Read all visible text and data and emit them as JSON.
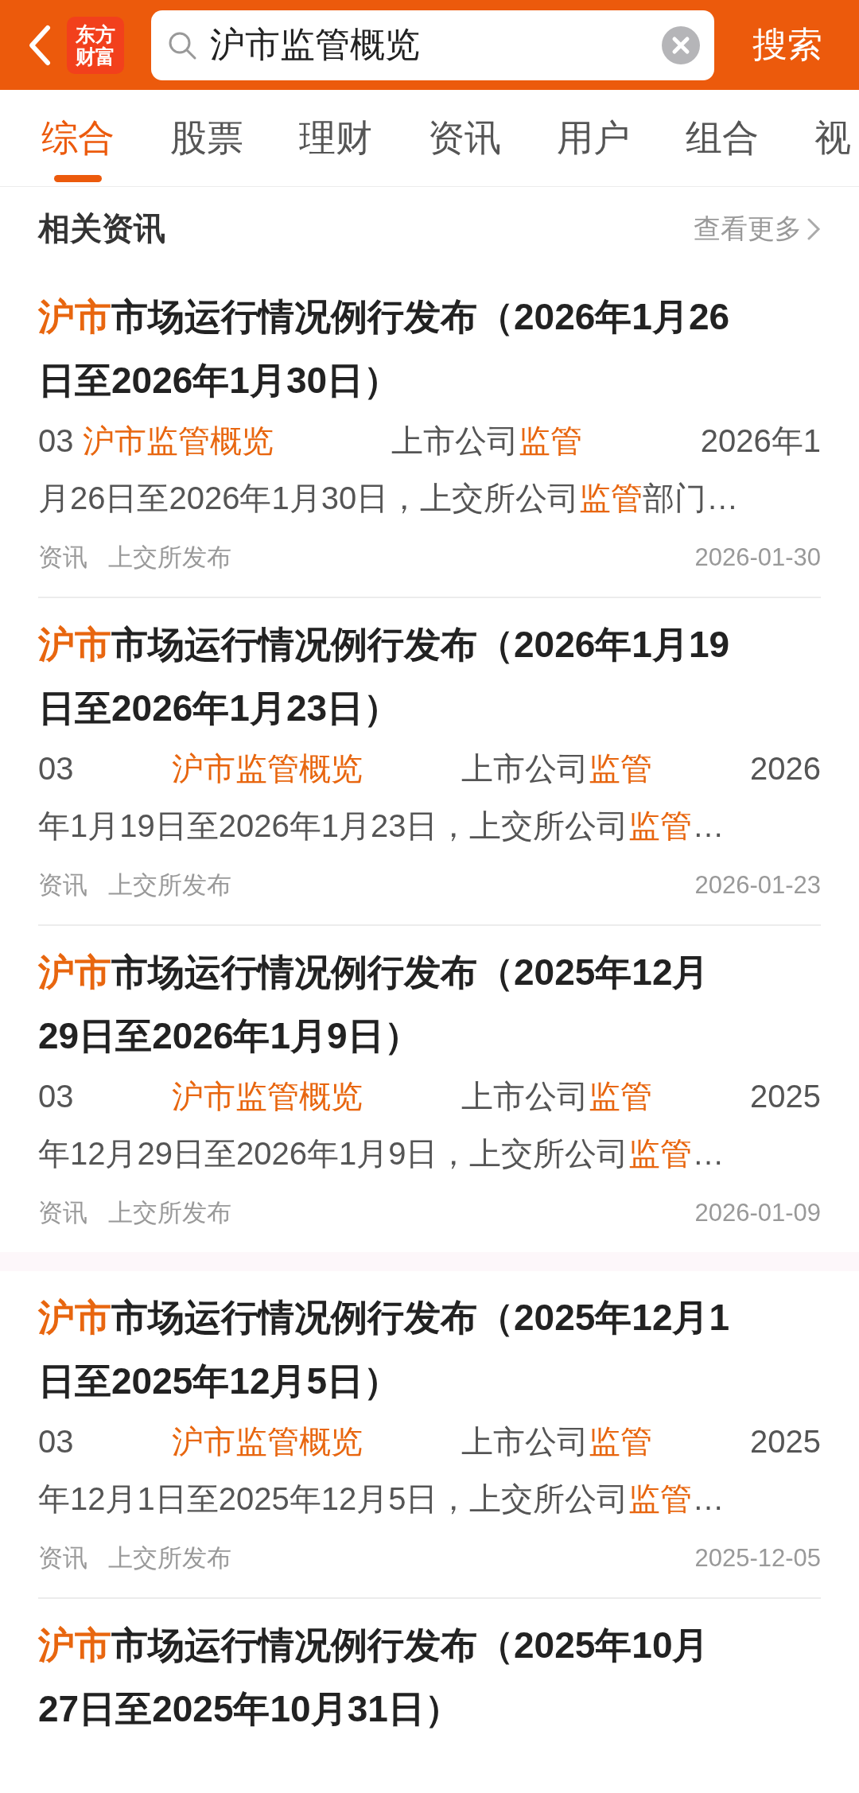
{
  "header": {
    "logo": [
      "东方",
      "财富"
    ],
    "search": {
      "value": "沪市监管概览"
    },
    "search_button": "搜索"
  },
  "tabs": [
    {
      "label": "综合",
      "selected": true
    },
    {
      "label": "股票",
      "selected": false
    },
    {
      "label": "理财",
      "selected": false
    },
    {
      "label": "资讯",
      "selected": false
    },
    {
      "label": "用户",
      "selected": false
    },
    {
      "label": "组合",
      "selected": false
    },
    {
      "label": "视",
      "selected": false
    }
  ],
  "section": {
    "title": "相关资讯",
    "more": "查看更多"
  },
  "news_groups": [
    [
      {
        "title": [
          [
            {
              "text": "沪市",
              "highlight": true
            },
            {
              "text": "市场运行情况例行发布（2026年1月26",
              "highlight": false
            }
          ],
          [
            {
              "text": "日至2026年1月30日）",
              "highlight": false
            }
          ]
        ],
        "snippet": [
          [
            [
              {
                "text": "03 ",
                "highlight": false
              },
              {
                "text": "沪市监管概览",
                "highlight": true
              }
            ],
            [
              {
                "text": "上市公司",
                "highlight": false
              },
              {
                "text": "监管",
                "highlight": true
              }
            ],
            [
              {
                "text": "2026年1",
                "highlight": false
              }
            ]
          ],
          [
            [
              {
                "text": "月26日至2026年1月30日，上交所公司",
                "highlight": false
              },
              {
                "text": "监管",
                "highlight": true
              },
              {
                "text": "部门…",
                "highlight": false
              }
            ]
          ]
        ],
        "meta": {
          "category": "资讯",
          "source": "上交所发布",
          "date": "2026-01-30"
        }
      },
      {
        "title": [
          [
            {
              "text": "沪市",
              "highlight": true
            },
            {
              "text": "市场运行情况例行发布（2026年1月19",
              "highlight": false
            }
          ],
          [
            {
              "text": "日至2026年1月23日）",
              "highlight": false
            }
          ]
        ],
        "snippet": [
          [
            [
              {
                "text": "03",
                "highlight": false
              }
            ],
            [
              {
                "text": "沪市监管概览",
                "highlight": true
              }
            ],
            [
              {
                "text": "上市公司",
                "highlight": false
              },
              {
                "text": "监管",
                "highlight": true
              }
            ],
            [
              {
                "text": "2026",
                "highlight": false
              }
            ]
          ],
          [
            [
              {
                "text": "年1月19日至2026年1月23日，上交所公司",
                "highlight": false
              },
              {
                "text": "监管",
                "highlight": true
              },
              {
                "text": "…",
                "highlight": false
              }
            ]
          ]
        ],
        "meta": {
          "category": "资讯",
          "source": "上交所发布",
          "date": "2026-01-23"
        }
      },
      {
        "title": [
          [
            {
              "text": "沪市",
              "highlight": true
            },
            {
              "text": "市场运行情况例行发布（2025年12月",
              "highlight": false
            }
          ],
          [
            {
              "text": "29日至2026年1月9日）",
              "highlight": false
            }
          ]
        ],
        "snippet": [
          [
            [
              {
                "text": "03",
                "highlight": false
              }
            ],
            [
              {
                "text": "沪市监管概览",
                "highlight": true
              }
            ],
            [
              {
                "text": "上市公司",
                "highlight": false
              },
              {
                "text": "监管",
                "highlight": true
              }
            ],
            [
              {
                "text": "2025",
                "highlight": false
              }
            ]
          ],
          [
            [
              {
                "text": "年12月29日至2026年1月9日，上交所公司",
                "highlight": false
              },
              {
                "text": "监管",
                "highlight": true
              },
              {
                "text": "…",
                "highlight": false
              }
            ]
          ]
        ],
        "meta": {
          "category": "资讯",
          "source": "上交所发布",
          "date": "2026-01-09"
        }
      }
    ],
    [
      {
        "title": [
          [
            {
              "text": "沪市",
              "highlight": true
            },
            {
              "text": "市场运行情况例行发布（2025年12月1",
              "highlight": false
            }
          ],
          [
            {
              "text": "日至2025年12月5日）",
              "highlight": false
            }
          ]
        ],
        "snippet": [
          [
            [
              {
                "text": "03",
                "highlight": false
              }
            ],
            [
              {
                "text": "沪市监管概览",
                "highlight": true
              }
            ],
            [
              {
                "text": "上市公司",
                "highlight": false
              },
              {
                "text": "监管",
                "highlight": true
              }
            ],
            [
              {
                "text": "2025",
                "highlight": false
              }
            ]
          ],
          [
            [
              {
                "text": "年12月1日至2025年12月5日，上交所公司",
                "highlight": false
              },
              {
                "text": "监管",
                "highlight": true
              },
              {
                "text": "…",
                "highlight": false
              }
            ]
          ]
        ],
        "meta": {
          "category": "资讯",
          "source": "上交所发布",
          "date": "2025-12-05"
        }
      },
      {
        "title": [
          [
            {
              "text": "沪市",
              "highlight": true
            },
            {
              "text": "市场运行情况例行发布（2025年10月",
              "highlight": false
            }
          ],
          [
            {
              "text": "27日至2025年10月31日）",
              "highlight": false
            }
          ]
        ]
      }
    ]
  ]
}
